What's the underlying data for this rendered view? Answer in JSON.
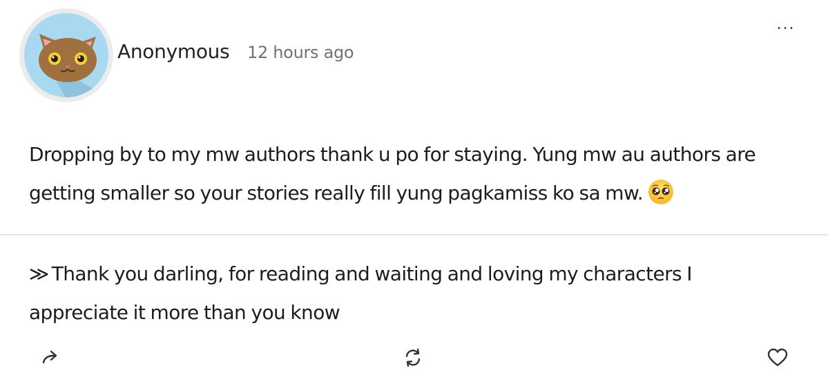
{
  "post": {
    "author": "Anonymous",
    "timestamp": "12 hours ago",
    "more_label": "...",
    "message": "Dropping by to my mw authors thank u po for staying. Yung mw au authors are getting smaller so your stories really fill yung pagkamiss ko sa mw.",
    "emoji": "pleading-face-emoji"
  },
  "reply": {
    "marker": "≫",
    "text": "Thank you darling, for reading and waiting and loving my characters I appreciate it more than you know"
  },
  "actions": {
    "share_icon": "share-arrow-icon",
    "repost_icon": "refresh-icon",
    "like_icon": "heart-icon"
  },
  "colors": {
    "avatar_background": "#a9d9f0",
    "cat_fur": "#a0703e",
    "timestamp": "#6e7277",
    "divider": "#e3e3e3"
  }
}
